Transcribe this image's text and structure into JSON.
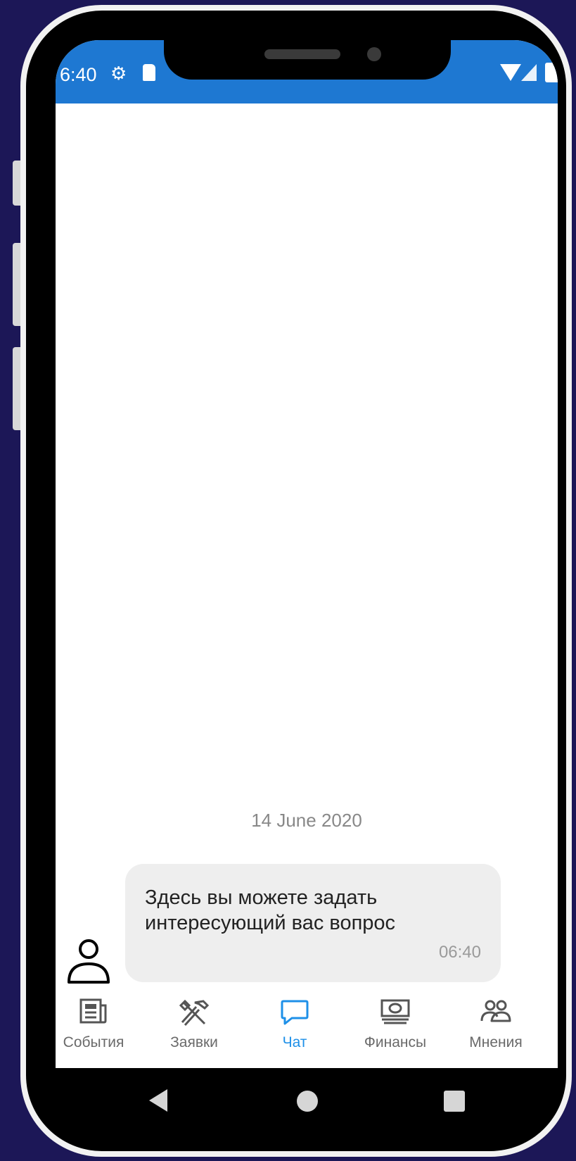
{
  "status_bar": {
    "time": "6:40",
    "icons": [
      "gear-icon",
      "sd-card-icon",
      "wifi-icon",
      "cell-signal-icon",
      "battery-icon"
    ],
    "color": "#1e78d2"
  },
  "chat": {
    "date_separator": "14 June 2020",
    "messages": [
      {
        "text": "Здесь вы можете задать интересующий вас вопрос",
        "time": "06:40",
        "sender_icon": "user-avatar-icon"
      }
    ]
  },
  "tabs": [
    {
      "label": "События",
      "icon": "newspaper-icon",
      "active": false
    },
    {
      "label": "Заявки",
      "icon": "tools-icon",
      "active": false
    },
    {
      "label": "Чат",
      "icon": "chat-bubble-icon",
      "active": true
    },
    {
      "label": "Финансы",
      "icon": "money-icon",
      "active": false
    },
    {
      "label": "Мнения",
      "icon": "people-icon",
      "active": false
    }
  ],
  "colors": {
    "background": "#1c1757",
    "accent": "#1e90e8",
    "bubble": "#eeeeee"
  }
}
